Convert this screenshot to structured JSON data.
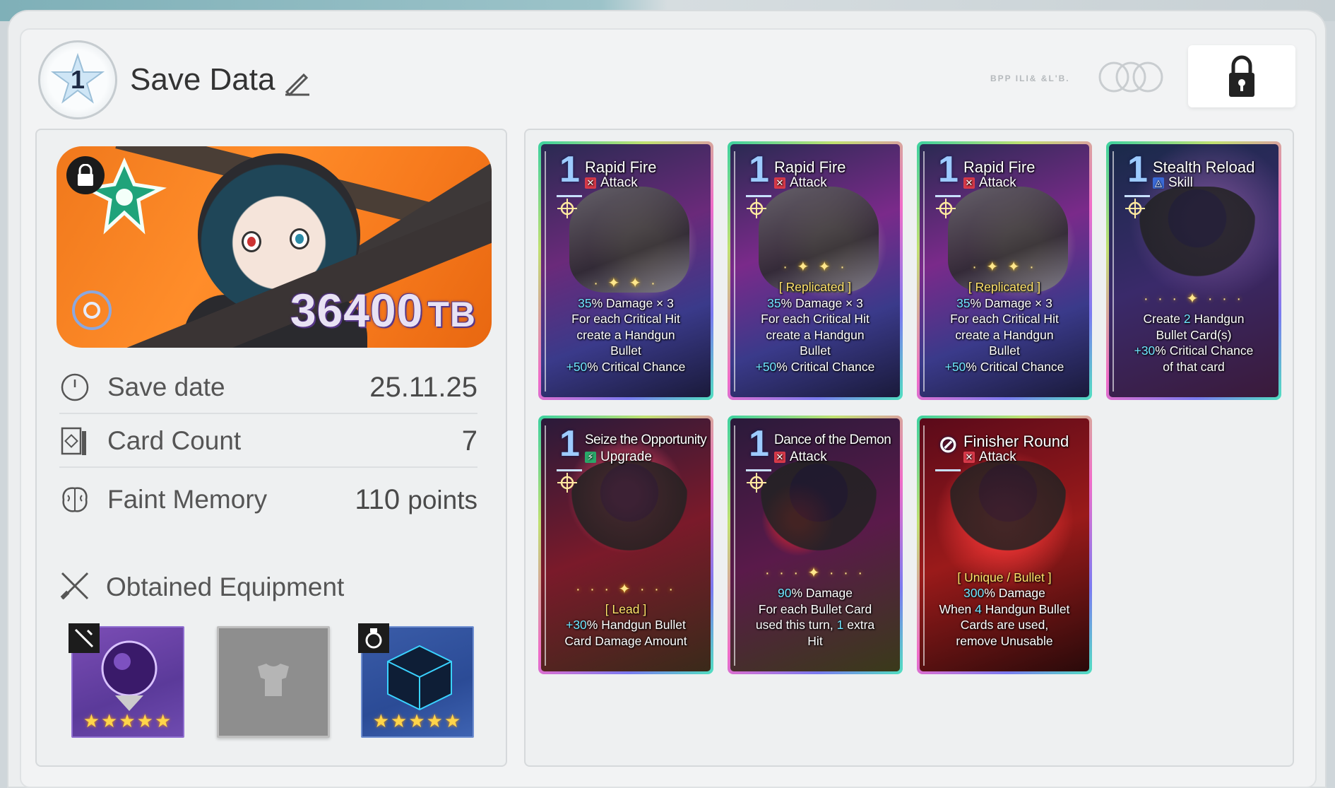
{
  "header": {
    "badge_number": "1",
    "title": "Save Data",
    "faint_text": "BPP ILI& &L'B."
  },
  "banner": {
    "tb_value": "36400",
    "tb_unit": "TB"
  },
  "stats": [
    {
      "icon": "clock-icon",
      "label": "Save date",
      "value": "25.11.25"
    },
    {
      "icon": "card-icon",
      "label": "Card Count",
      "value": "7"
    },
    {
      "icon": "brain-icon",
      "label": "Faint Memory",
      "value": "110",
      "unit": "points"
    }
  ],
  "equipment": {
    "title": "Obtained Equipment",
    "slots": [
      {
        "name": "weapon-slot",
        "type_icon": "crossed-swords-icon",
        "stars": "★★★★★",
        "filled": true
      },
      {
        "name": "armor-slot",
        "type_icon": "armor-icon",
        "stars": "",
        "filled": false
      },
      {
        "name": "accessory-slot",
        "type_icon": "ring-icon",
        "stars": "★★★★★",
        "filled": true
      }
    ]
  },
  "cards": [
    {
      "cost": "1",
      "name": "Rapid Fire",
      "type": "Attack",
      "type_icon": "attack-icon",
      "tag": "",
      "sparkle": "· ✦ ✦ ·",
      "lines": [
        [
          {
            "t": "35",
            "hl": true
          },
          {
            "t": "% Damage × 3"
          }
        ],
        [
          {
            "t": "For each Critical Hit"
          }
        ],
        [
          {
            "t": "create a Handgun"
          }
        ],
        [
          {
            "t": "Bullet"
          }
        ],
        [
          {
            "t": "+50",
            "hl": true
          },
          {
            "t": "% Critical Chance"
          }
        ]
      ]
    },
    {
      "cost": "1",
      "name": "Rapid Fire",
      "type": "Attack",
      "type_icon": "attack-icon",
      "tag": "[ Replicated ]",
      "sparkle": "· ✦ ✦ ·",
      "lines": [
        [
          {
            "t": "35",
            "hl": true
          },
          {
            "t": "% Damage × 3"
          }
        ],
        [
          {
            "t": "For each Critical Hit"
          }
        ],
        [
          {
            "t": "create a Handgun"
          }
        ],
        [
          {
            "t": "Bullet"
          }
        ],
        [
          {
            "t": "+50",
            "hl": true
          },
          {
            "t": "% Critical Chance"
          }
        ]
      ]
    },
    {
      "cost": "1",
      "name": "Rapid Fire",
      "type": "Attack",
      "type_icon": "attack-icon",
      "tag": "[ Replicated ]",
      "sparkle": "· ✦ ✦ ·",
      "lines": [
        [
          {
            "t": "35",
            "hl": true
          },
          {
            "t": "% Damage × 3"
          }
        ],
        [
          {
            "t": "For each Critical Hit"
          }
        ],
        [
          {
            "t": "create a Handgun"
          }
        ],
        [
          {
            "t": "Bullet"
          }
        ],
        [
          {
            "t": "+50",
            "hl": true
          },
          {
            "t": "% Critical Chance"
          }
        ]
      ]
    },
    {
      "cost": "1",
      "name": "Stealth Reload",
      "type": "Skill",
      "type_icon": "skill-icon",
      "tag": "",
      "sparkle": "· · · ✦ · · ·",
      "lines": [
        [
          {
            "t": "Create "
          },
          {
            "t": "2",
            "hl": true
          },
          {
            "t": " Handgun"
          }
        ],
        [
          {
            "t": "Bullet Card(s)"
          }
        ],
        [
          {
            "t": "+30",
            "hl": true
          },
          {
            "t": "% Critical Chance"
          }
        ],
        [
          {
            "t": "of that card"
          }
        ]
      ]
    },
    {
      "cost": "1",
      "name": "Seize the Opportunity",
      "type": "Upgrade",
      "type_icon": "upgrade-icon",
      "tag": "[ Lead ]",
      "sparkle": "· · · ✦ · · ·",
      "lines": [
        [
          {
            "t": "+30",
            "hl": true
          },
          {
            "t": "% Handgun Bullet"
          }
        ],
        [
          {
            "t": "Card Damage Amount"
          }
        ]
      ]
    },
    {
      "cost": "1",
      "name": "Dance of the Demon",
      "type": "Attack",
      "type_icon": "attack-icon",
      "tag": "",
      "sparkle": "· · · ✦ · · ·",
      "lines": [
        [
          {
            "t": "90",
            "hl": true
          },
          {
            "t": "% Damage"
          }
        ],
        [
          {
            "t": "For each Bullet Card"
          }
        ],
        [
          {
            "t": "used this turn, "
          },
          {
            "t": "1",
            "hl": true
          },
          {
            "t": " extra"
          }
        ],
        [
          {
            "t": "Hit"
          }
        ]
      ]
    },
    {
      "cost": "⊘",
      "name": "Finisher Round",
      "type": "Attack",
      "type_icon": "attack-icon",
      "tag": "[ Unique / Bullet ]",
      "sparkle": "",
      "lines": [
        [
          {
            "t": "300",
            "hl": true
          },
          {
            "t": "% Damage"
          }
        ],
        [
          {
            "t": "When "
          },
          {
            "t": "4",
            "hl": true
          },
          {
            "t": " Handgun Bullet"
          }
        ],
        [
          {
            "t": "Cards are used,"
          }
        ],
        [
          {
            "t": "remove Unusable"
          }
        ]
      ]
    }
  ],
  "colors": {
    "accent_cyan": "#6fe6ff",
    "tag_yellow": "#ffe36a",
    "banner_orange": "#f77a1d",
    "tb_text": "#e8e2f4"
  }
}
